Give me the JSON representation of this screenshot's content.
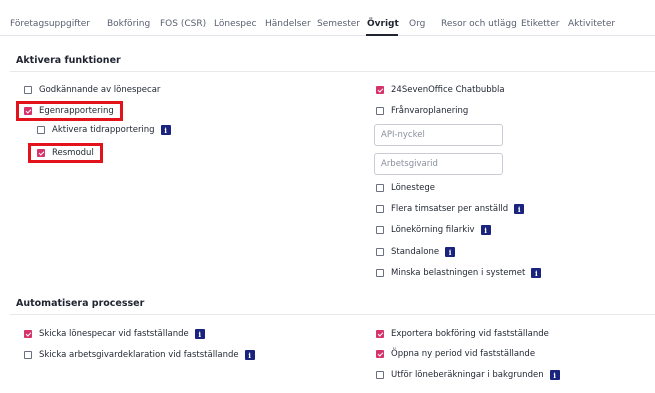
{
  "tabs": [
    {
      "label": "Företagsuppgifter"
    },
    {
      "label": "Bokföring"
    },
    {
      "label": "FOS (CSR)"
    },
    {
      "label": "Lönespec"
    },
    {
      "label": "Händelser"
    },
    {
      "label": "Semester"
    },
    {
      "label": "Övrigt",
      "active": true
    },
    {
      "label": "Org"
    },
    {
      "label": "Resor och utlägg"
    },
    {
      "label": "Etiketter"
    },
    {
      "label": "Aktiviteter"
    }
  ],
  "sections": {
    "activate": {
      "title": "Aktivera funktioner"
    },
    "automate": {
      "title": "Automatisera processer"
    }
  },
  "info_icon": {
    "glyph": "i",
    "name": "info-icon",
    "color": "#1a237e"
  },
  "colors": {
    "accent": "#d6336c",
    "highlight": "#e3131b"
  },
  "activate_left": [
    {
      "label": "Godkännande av lönespecar",
      "checked": false
    },
    {
      "label": "Egenrapportering",
      "checked": true,
      "highlighted": true
    },
    {
      "label": "Aktivera tidrapportering",
      "checked": false,
      "info": true
    },
    {
      "label": "Resmodul",
      "checked": true,
      "highlighted": true
    }
  ],
  "activate_right": [
    {
      "label": "24SevenOffice Chatbubbla",
      "checked": true
    },
    {
      "label": "Frånvaroplanering",
      "checked": false
    },
    {
      "label": "Lönestege",
      "checked": false
    },
    {
      "label": "Flera timsatser per anställd",
      "checked": false,
      "info": true
    },
    {
      "label": "Lönekörning filarkiv",
      "checked": false,
      "info": true
    },
    {
      "label": "Standalone",
      "checked": false,
      "info": true
    },
    {
      "label": "Minska belastningen i systemet",
      "checked": false,
      "info": true
    }
  ],
  "fields": {
    "api_key": {
      "placeholder": "API-nyckel",
      "value": ""
    },
    "employer": {
      "placeholder": "Arbetsgivarid",
      "value": ""
    }
  },
  "automate_left": [
    {
      "label": "Skicka lönespecar vid fastställande",
      "checked": true,
      "info": true
    },
    {
      "label": "Skicka arbetsgivardeklaration vid fastställande",
      "checked": false,
      "info": true
    }
  ],
  "automate_right": [
    {
      "label": "Exportera bokföring vid fastställande",
      "checked": true
    },
    {
      "label": "Öppna ny period vid fastställande",
      "checked": true
    },
    {
      "label": "Utför löneberäkningar i bakgrunden",
      "checked": false,
      "info": true
    }
  ]
}
